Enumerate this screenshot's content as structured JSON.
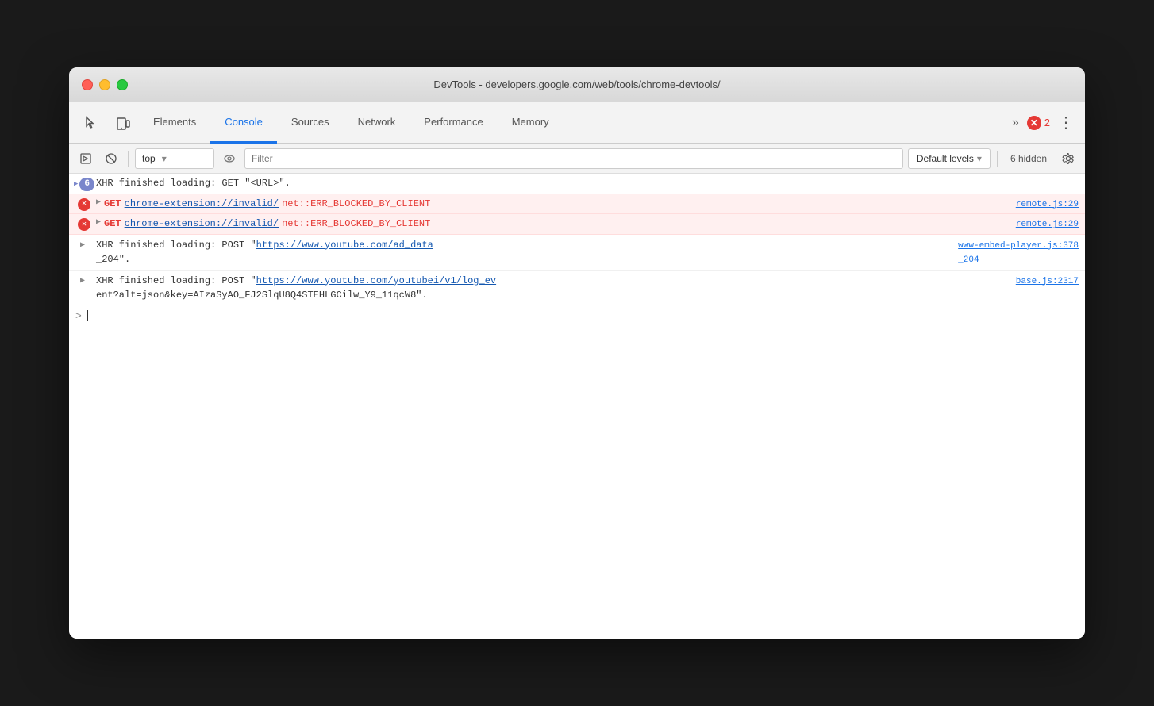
{
  "window": {
    "title": "DevTools - developers.google.com/web/tools/chrome-devtools/"
  },
  "trafficLights": {
    "close": "close",
    "minimize": "minimize",
    "maximize": "maximize"
  },
  "tabs": [
    {
      "id": "elements",
      "label": "Elements",
      "active": false
    },
    {
      "id": "console",
      "label": "Console",
      "active": true
    },
    {
      "id": "sources",
      "label": "Sources",
      "active": false
    },
    {
      "id": "network",
      "label": "Network",
      "active": false
    },
    {
      "id": "performance",
      "label": "Performance",
      "active": false
    },
    {
      "id": "memory",
      "label": "Memory",
      "active": false
    }
  ],
  "tabbar": {
    "more_label": "»",
    "error_count": "2",
    "menu_label": "⋮"
  },
  "toolbar": {
    "run_label": "▶",
    "clear_label": "🚫",
    "context_value": "top",
    "context_arrow": "▾",
    "eye_label": "👁",
    "filter_placeholder": "Filter",
    "levels_label": "Default levels",
    "levels_arrow": "▾",
    "hidden_label": "6 hidden",
    "settings_label": "⚙"
  },
  "console": {
    "rows": [
      {
        "id": "row1",
        "type": "xhr",
        "badge": "6",
        "text": "XHR finished loading: GET \"<URL>\".",
        "source": null
      },
      {
        "id": "row2",
        "type": "error",
        "method": "GET",
        "url": "chrome-extension://invalid/",
        "error": "net::ERR_BLOCKED_BY_CLIENT",
        "source": "remote.js:29"
      },
      {
        "id": "row3",
        "type": "error",
        "method": "GET",
        "url": "chrome-extension://invalid/",
        "error": "net::ERR_BLOCKED_BY_CLIENT",
        "source": "remote.js:29"
      },
      {
        "id": "row4",
        "type": "xhr2",
        "text1": "XHR finished loading: POST \"",
        "url": "https://www.youtube.com/ad_data",
        "text2": "\".",
        "source": "www-embed-player.js:378\n_204",
        "source_line1": "www-embed-player.js:378",
        "source_line2": "_204"
      },
      {
        "id": "row5",
        "type": "xhr3",
        "text1": "XHR finished loading: POST \"",
        "url": "https://www.youtube.com/youtubei/v1/log_ev",
        "text2_line1": "ent?alt=json&key=AIzaSyAO_FJ2SlqU8Q4STEHLGCilw_Y9_11qcW8",
        "text2_end": "\".",
        "source_line1": "base.js:2317",
        "source_line2": ""
      }
    ],
    "prompt": ">",
    "cursor": "|"
  }
}
